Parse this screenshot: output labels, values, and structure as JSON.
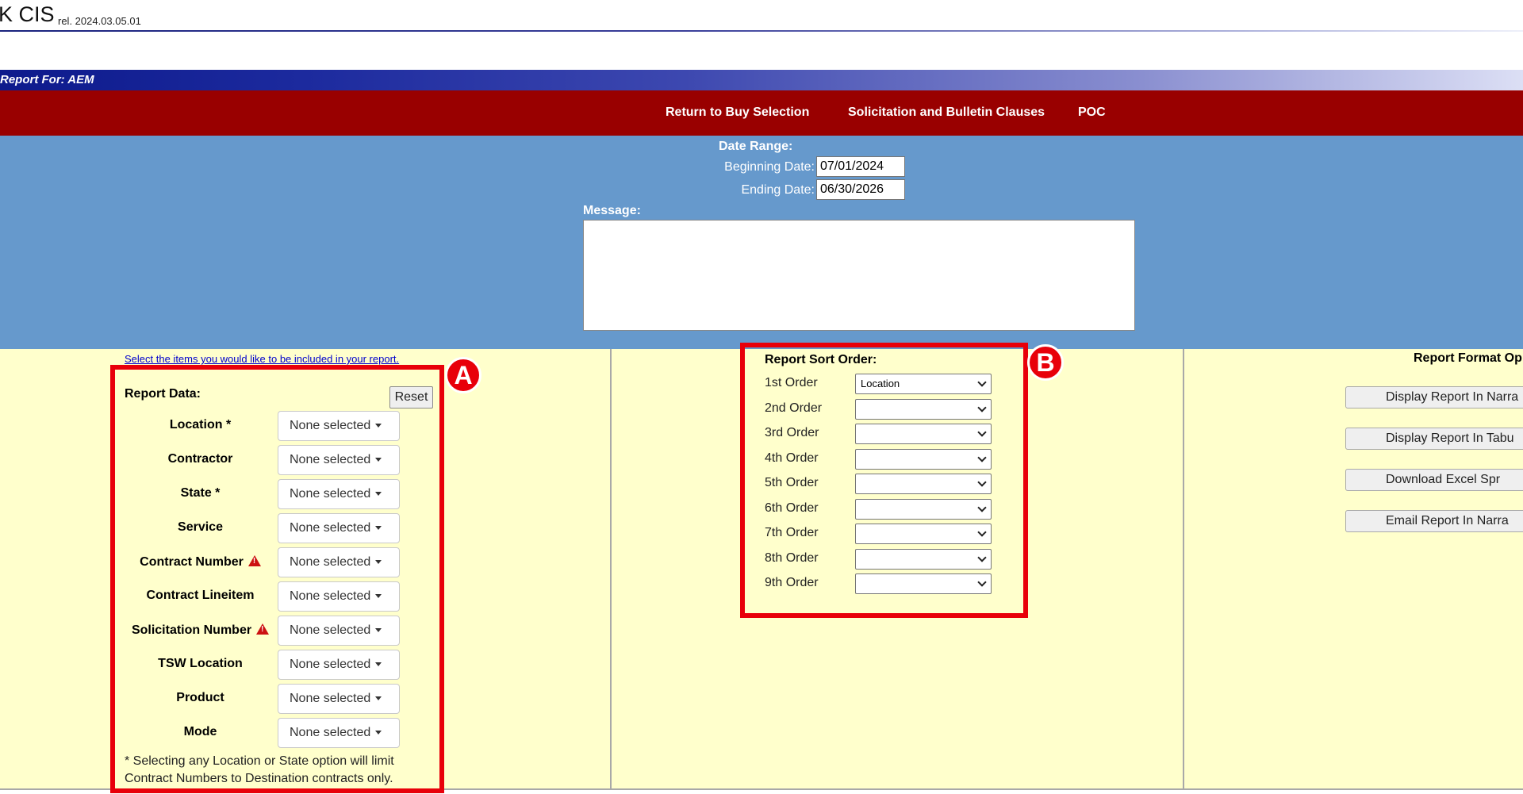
{
  "header": {
    "app_title": "K CIS",
    "release": "rel. 2024.03.05.01",
    "report_for": "Report For: AEM"
  },
  "nav": {
    "items": [
      {
        "label": "Return to Buy Selection"
      },
      {
        "label": "Solicitation and Bulletin Clauses"
      },
      {
        "label": "POC"
      }
    ]
  },
  "date_range": {
    "title": "Date Range:",
    "beginning_label": "Beginning Date:",
    "beginning_value": "07/01/2024",
    "ending_label": "Ending Date:",
    "ending_value": "06/30/2026"
  },
  "message": {
    "label": "Message:",
    "value": ""
  },
  "report_data": {
    "hint": "Select the items you would like to be included in your report.",
    "title": "Report Data:",
    "reset_label": "Reset",
    "fields": [
      {
        "label": "Location *",
        "value": "None selected",
        "warning": false
      },
      {
        "label": "Contractor",
        "value": "None selected",
        "warning": false
      },
      {
        "label": "State *",
        "value": "None selected",
        "warning": false
      },
      {
        "label": "Service",
        "value": "None selected",
        "warning": false
      },
      {
        "label": "Contract Number",
        "value": "None selected",
        "warning": true
      },
      {
        "label": "Contract Lineitem",
        "value": "None selected",
        "warning": false
      },
      {
        "label": "Solicitation Number",
        "value": "None selected",
        "warning": true
      },
      {
        "label": "TSW Location",
        "value": "None selected",
        "warning": false
      },
      {
        "label": "Product",
        "value": "None selected",
        "warning": false
      },
      {
        "label": "Mode",
        "value": "None selected",
        "warning": false
      }
    ],
    "footnote": "* Selecting any Location or State option will limit Contract Numbers to Destination contracts only."
  },
  "sort_order": {
    "title": "Report Sort Order:",
    "rows": [
      {
        "label": "1st Order",
        "value": "Location"
      },
      {
        "label": "2nd Order",
        "value": ""
      },
      {
        "label": "3rd Order",
        "value": ""
      },
      {
        "label": "4th Order",
        "value": ""
      },
      {
        "label": "5th Order",
        "value": ""
      },
      {
        "label": "6th Order",
        "value": ""
      },
      {
        "label": "7th Order",
        "value": ""
      },
      {
        "label": "8th Order",
        "value": ""
      },
      {
        "label": "9th Order",
        "value": ""
      }
    ]
  },
  "report_format": {
    "title": "Report Format Op",
    "buttons": [
      {
        "label": "Display Report In Narra"
      },
      {
        "label": "Display Report In Tabu"
      },
      {
        "label": "Download Excel Spr"
      },
      {
        "label": "Email Report In Narra"
      }
    ]
  },
  "annotations": {
    "marker_a": "A",
    "marker_b": "B"
  },
  "colors": {
    "nav_red": "#990000",
    "date_panel_blue": "#6699cc",
    "options_panel_yellow": "#ffffcc",
    "annotation_red": "#e8000a",
    "hint_link_blue": "#0000cc"
  }
}
